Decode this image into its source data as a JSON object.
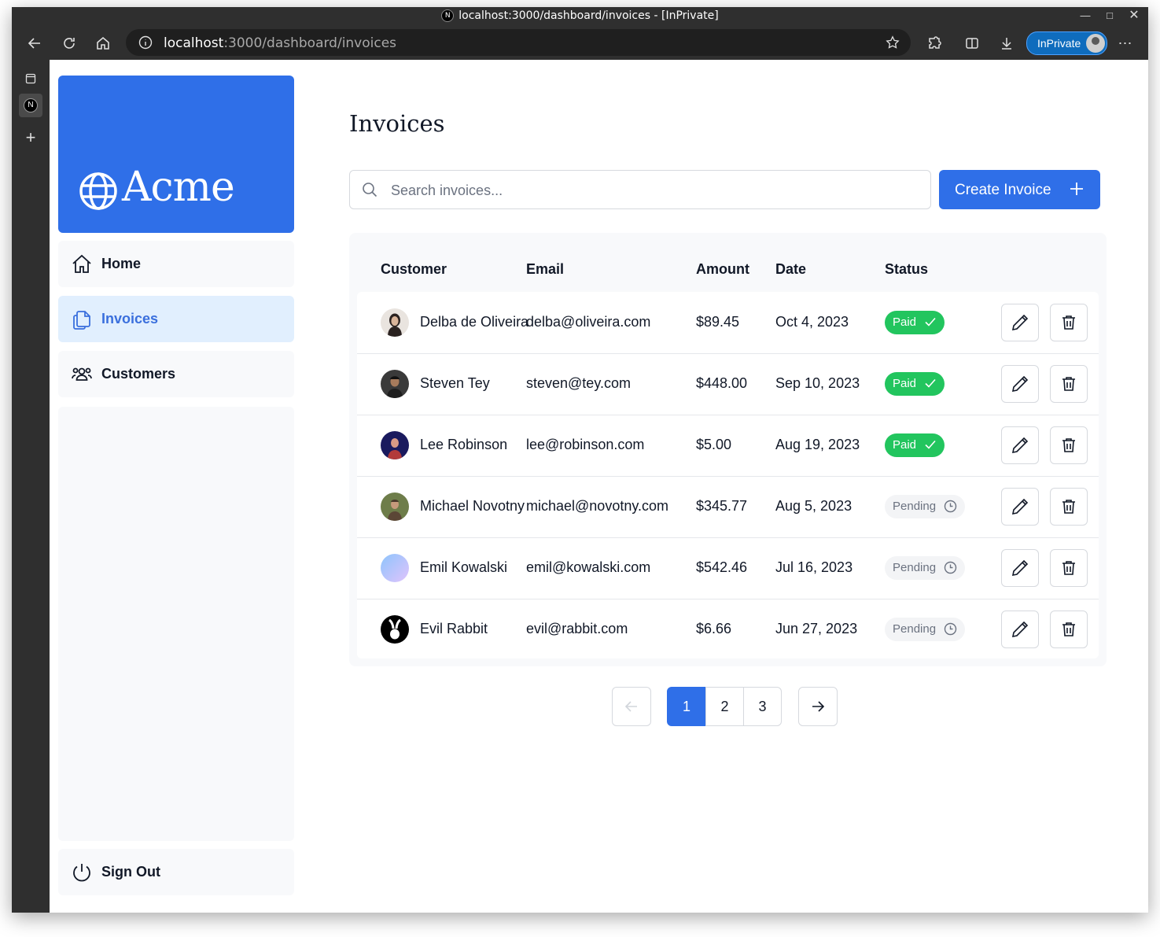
{
  "browser": {
    "window_title": "localhost:3000/dashboard/invoices - [InPrivate]",
    "url_host": "localhost",
    "url_path": ":3000/dashboard/invoices",
    "inprivate_label": "InPrivate"
  },
  "sidebar": {
    "logo_text": "Acme",
    "nav": [
      {
        "label": "Home",
        "icon": "home-icon"
      },
      {
        "label": "Invoices",
        "icon": "document-duplicate-icon",
        "active": true
      },
      {
        "label": "Customers",
        "icon": "user-group-icon"
      }
    ],
    "sign_out_label": "Sign Out"
  },
  "main": {
    "title": "Invoices",
    "search_placeholder": "Search invoices...",
    "create_label": "Create Invoice"
  },
  "table": {
    "headers": [
      "Customer",
      "Email",
      "Amount",
      "Date",
      "Status"
    ],
    "rows": [
      {
        "name": "Delba de Oliveira",
        "email": "delba@oliveira.com",
        "amount": "$89.45",
        "date": "Oct 4, 2023",
        "status": "Paid"
      },
      {
        "name": "Steven Tey",
        "email": "steven@tey.com",
        "amount": "$448.00",
        "date": "Sep 10, 2023",
        "status": "Paid"
      },
      {
        "name": "Lee Robinson",
        "email": "lee@robinson.com",
        "amount": "$5.00",
        "date": "Aug 19, 2023",
        "status": "Paid"
      },
      {
        "name": "Michael Novotny",
        "email": "michael@novotny.com",
        "amount": "$345.77",
        "date": "Aug 5, 2023",
        "status": "Pending"
      },
      {
        "name": "Emil Kowalski",
        "email": "emil@kowalski.com",
        "amount": "$542.46",
        "date": "Jul 16, 2023",
        "status": "Pending"
      },
      {
        "name": "Evil Rabbit",
        "email": "evil@rabbit.com",
        "amount": "$6.66",
        "date": "Jun 27, 2023",
        "status": "Pending"
      }
    ]
  },
  "pagination": {
    "pages": [
      "1",
      "2",
      "3"
    ],
    "current": "1"
  },
  "colors": {
    "brand": "#2f6fe8",
    "paid": "#22c55e",
    "pending_bg": "#f3f4f6",
    "active_nav_bg": "#e1effe"
  }
}
